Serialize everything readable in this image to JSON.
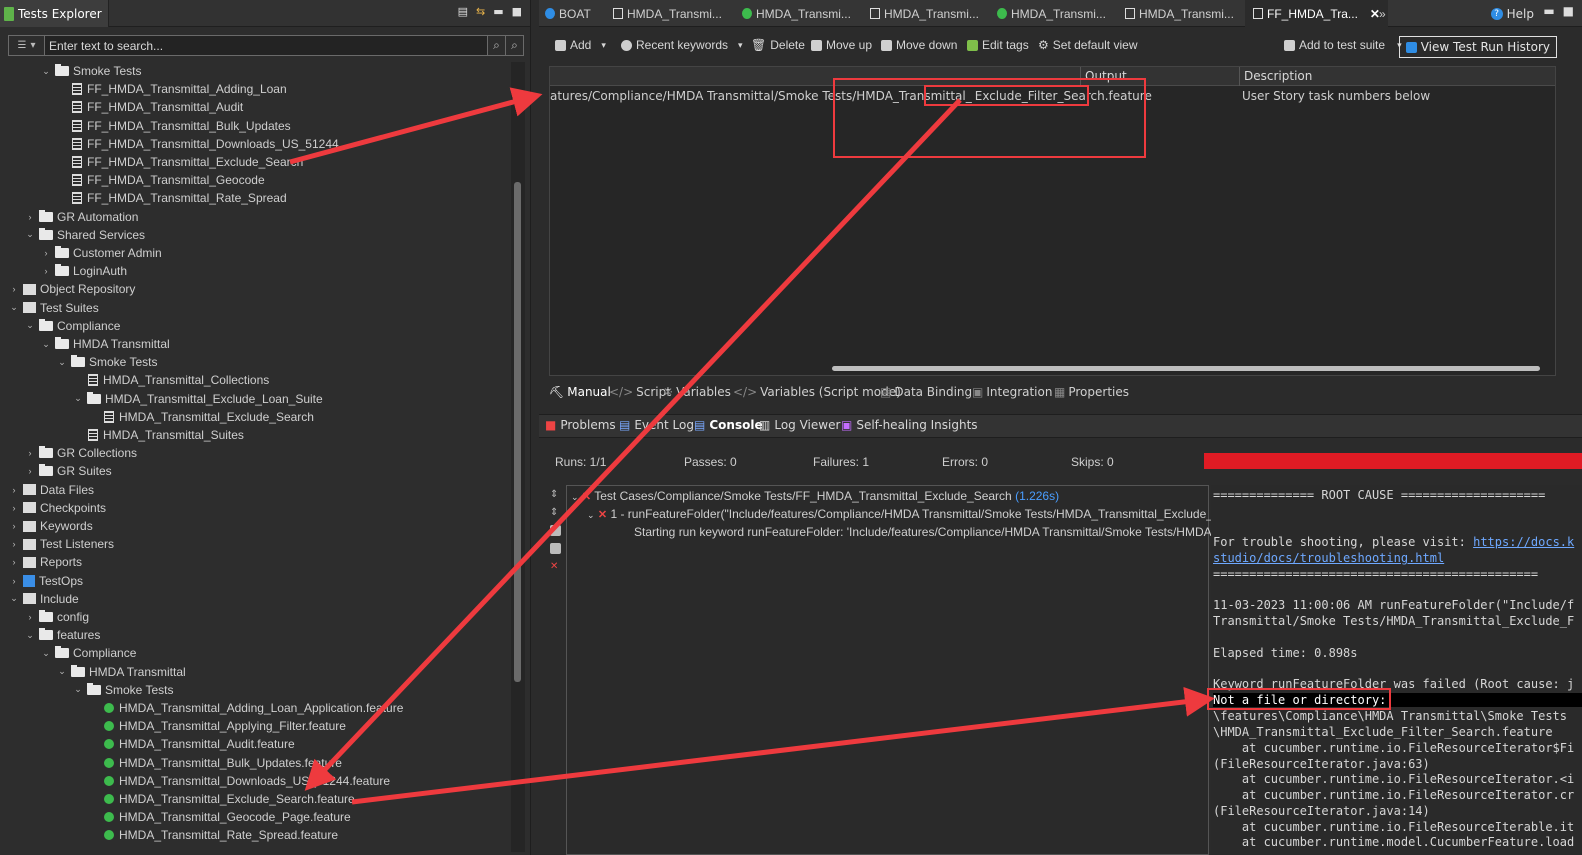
{
  "explorer": {
    "title": "Tests Explorer",
    "search_placeholder": "Enter text to search...",
    "tree": [
      {
        "indent": 2,
        "chev": "v",
        "icon": "folder",
        "label": "Smoke Tests"
      },
      {
        "indent": 3,
        "chev": "",
        "icon": "doc",
        "label": "FF_HMDA_Transmittal_Adding_Loan"
      },
      {
        "indent": 3,
        "chev": "",
        "icon": "doc",
        "label": "FF_HMDA_Transmittal_Audit"
      },
      {
        "indent": 3,
        "chev": "",
        "icon": "doc",
        "label": "FF_HMDA_Transmittal_Bulk_Updates"
      },
      {
        "indent": 3,
        "chev": "",
        "icon": "doc",
        "label": "FF_HMDA_Transmittal_Downloads_US_51244"
      },
      {
        "indent": 3,
        "chev": "",
        "icon": "doc",
        "label": "FF_HMDA_Transmittal_Exclude_Search"
      },
      {
        "indent": 3,
        "chev": "",
        "icon": "doc",
        "label": "FF_HMDA_Transmittal_Geocode"
      },
      {
        "indent": 3,
        "chev": "",
        "icon": "doc",
        "label": "FF_HMDA_Transmittal_Rate_Spread"
      },
      {
        "indent": 1,
        "chev": ">",
        "icon": "folder",
        "label": "GR Automation"
      },
      {
        "indent": 1,
        "chev": "v",
        "icon": "folder",
        "label": "Shared Services"
      },
      {
        "indent": 2,
        "chev": ">",
        "icon": "folder",
        "label": "Customer Admin"
      },
      {
        "indent": 2,
        "chev": ">",
        "icon": "folder",
        "label": "LoginAuth"
      },
      {
        "indent": 0,
        "chev": ">",
        "icon": "special",
        "label": "Object Repository"
      },
      {
        "indent": 0,
        "chev": "v",
        "icon": "special",
        "label": "Test Suites"
      },
      {
        "indent": 1,
        "chev": "v",
        "icon": "folder",
        "label": "Compliance"
      },
      {
        "indent": 2,
        "chev": "v",
        "icon": "folder",
        "label": "HMDA Transmittal"
      },
      {
        "indent": 3,
        "chev": "v",
        "icon": "folder",
        "label": "Smoke Tests"
      },
      {
        "indent": 4,
        "chev": "",
        "icon": "doc",
        "label": "HMDA_Transmittal_Collections"
      },
      {
        "indent": 4,
        "chev": "v",
        "icon": "folder",
        "label": "HMDA_Transmittal_Exclude_Loan_Suite"
      },
      {
        "indent": 5,
        "chev": "",
        "icon": "doc",
        "label": "HMDA_Transmittal_Exclude_Search"
      },
      {
        "indent": 4,
        "chev": "",
        "icon": "doc",
        "label": "HMDA_Transmittal_Suites"
      },
      {
        "indent": 1,
        "chev": ">",
        "icon": "folder",
        "label": "GR Collections"
      },
      {
        "indent": 1,
        "chev": ">",
        "icon": "folder",
        "label": "GR Suites"
      },
      {
        "indent": 0,
        "chev": ">",
        "icon": "special",
        "label": "Data Files"
      },
      {
        "indent": 0,
        "chev": ">",
        "icon": "special",
        "label": "Checkpoints"
      },
      {
        "indent": 0,
        "chev": ">",
        "icon": "special",
        "label": "Keywords"
      },
      {
        "indent": 0,
        "chev": ">",
        "icon": "special",
        "label": "Test Listeners"
      },
      {
        "indent": 0,
        "chev": ">",
        "icon": "special",
        "label": "Reports"
      },
      {
        "indent": 0,
        "chev": ">",
        "icon": "testops",
        "label": "TestOps"
      },
      {
        "indent": 0,
        "chev": "v",
        "icon": "special",
        "label": "Include"
      },
      {
        "indent": 1,
        "chev": ">",
        "icon": "folder",
        "label": "config"
      },
      {
        "indent": 1,
        "chev": "v",
        "icon": "folder",
        "label": "features"
      },
      {
        "indent": 2,
        "chev": "v",
        "icon": "folder",
        "label": "Compliance"
      },
      {
        "indent": 3,
        "chev": "v",
        "icon": "folder",
        "label": "HMDA Transmittal"
      },
      {
        "indent": 4,
        "chev": "v",
        "icon": "folder",
        "label": "Smoke Tests"
      },
      {
        "indent": 5,
        "chev": "",
        "icon": "feature",
        "label": "HMDA_Transmittal_Adding_Loan_Application.feature"
      },
      {
        "indent": 5,
        "chev": "",
        "icon": "feature",
        "label": "HMDA_Transmittal_Applying_Filter.feature"
      },
      {
        "indent": 5,
        "chev": "",
        "icon": "feature",
        "label": "HMDA_Transmittal_Audit.feature"
      },
      {
        "indent": 5,
        "chev": "",
        "icon": "feature",
        "label": "HMDA_Transmittal_Bulk_Updates.feature"
      },
      {
        "indent": 5,
        "chev": "",
        "icon": "feature",
        "label": "HMDA_Transmittal_Downloads_US_51244.feature"
      },
      {
        "indent": 5,
        "chev": "",
        "icon": "feature",
        "label": "HMDA_Transmittal_Exclude_Search.feature"
      },
      {
        "indent": 5,
        "chev": "",
        "icon": "feature",
        "label": "HMDA_Transmittal_Geocode_Page.feature"
      },
      {
        "indent": 5,
        "chev": "",
        "icon": "feature",
        "label": "HMDA_Transmittal_Rate_Spread.feature"
      }
    ]
  },
  "editor_tabs": {
    "t0": "BOAT",
    "t1": "HMDA_Transmi...",
    "t2": "HMDA_Transmi...",
    "t3": "HMDA_Transmi...",
    "t4": "HMDA_Transmi...",
    "t5": "HMDA_Transmi...",
    "t6": "FF_HMDA_Tra...",
    "more": "»",
    "help": "Help"
  },
  "toolbar": {
    "add": "Add",
    "recent": "Recent keywords",
    "delete": "Delete",
    "move_up": "Move up",
    "move_down": "Move down",
    "edit_tags": "Edit tags",
    "set_default": "Set default view",
    "add_suite": "Add to test suite",
    "view_history": "View Test Run History"
  },
  "table": {
    "col_output": "Output",
    "col_description": "Description",
    "path_prefix": "atures/Compliance/HMDA Transmittal/Smoke Tests/HMDA_Transmittal_",
    "path_highlight": "Exclude_Filter_Search.feature",
    "description": "User Story task numbers below"
  },
  "modes": {
    "manual": "Manual",
    "script": "Script",
    "variables": "Variables",
    "variables_script": "Variables (Script mode)",
    "data_binding": "Data Binding",
    "integration": "Integration",
    "properties": "Properties"
  },
  "console_tabs": {
    "problems": "Problems",
    "event_log": "Event Log",
    "console": "Console",
    "log_viewer": "Log Viewer",
    "self_healing": "Self-healing Insights"
  },
  "stats": {
    "runs": "Runs: 1/1",
    "passes": "Passes: 0",
    "failures": "Failures: 1",
    "errors": "Errors: 0",
    "skips": "Skips: 0",
    "progress_fraction": 1.0,
    "bar_color": "#e01b24"
  },
  "results": {
    "l1": "Test Cases/Compliance/Smoke Tests/FF_HMDA_Transmittal_Exclude_Search",
    "l1_time": "(1.226s)",
    "l2": "1 - runFeatureFolder(\"Include/features/Compliance/HMDA Transmittal/Smoke Tests/HMDA_Transmittal_Exclude_",
    "l3": "Starting run keyword runFeatureFolder: 'Include/features/Compliance/HMDA Transmittal/Smoke Tests/HMDA_"
  },
  "log": {
    "l1": "============== ROOT CAUSE ====================",
    "l2": "For trouble shooting, please visit: ",
    "l2_link": "https://docs.k",
    "l3_link": "studio/docs/troubleshooting.html",
    "l4": "=============================================",
    "l5": "11-03-2023 11:00:06 AM runFeatureFolder(\"Include/f",
    "l6": "Transmittal/Smoke Tests/HMDA_Transmittal_Exclude_F",
    "l7": "Elapsed time: 0.898s",
    "l8": "Keyword runFeatureFolder was failed (Root cause: j",
    "l9": "Not a file or directory:",
    "l10": "\\features\\Compliance\\HMDA Transmittal\\Smoke Tests",
    "l11": "\\HMDA_Transmittal_Exclude_Filter_Search.feature",
    "l12": "    at cucumber.runtime.io.FileResourceIterator$Fi",
    "l13": "(FileResourceIterator.java:63)",
    "l14": "    at cucumber.runtime.io.FileResourceIterator.<i",
    "l15": "    at cucumber.runtime.io.FileResourceIterator.cr",
    "l16": "(FileResourceIterator.java:14)",
    "l17": "    at cucumber.runtime.io.FileResourceIterable.it",
    "l18": "    at cucumber.runtime.model.CucumberFeature.load"
  },
  "annotation_color": "#ee3a3e"
}
